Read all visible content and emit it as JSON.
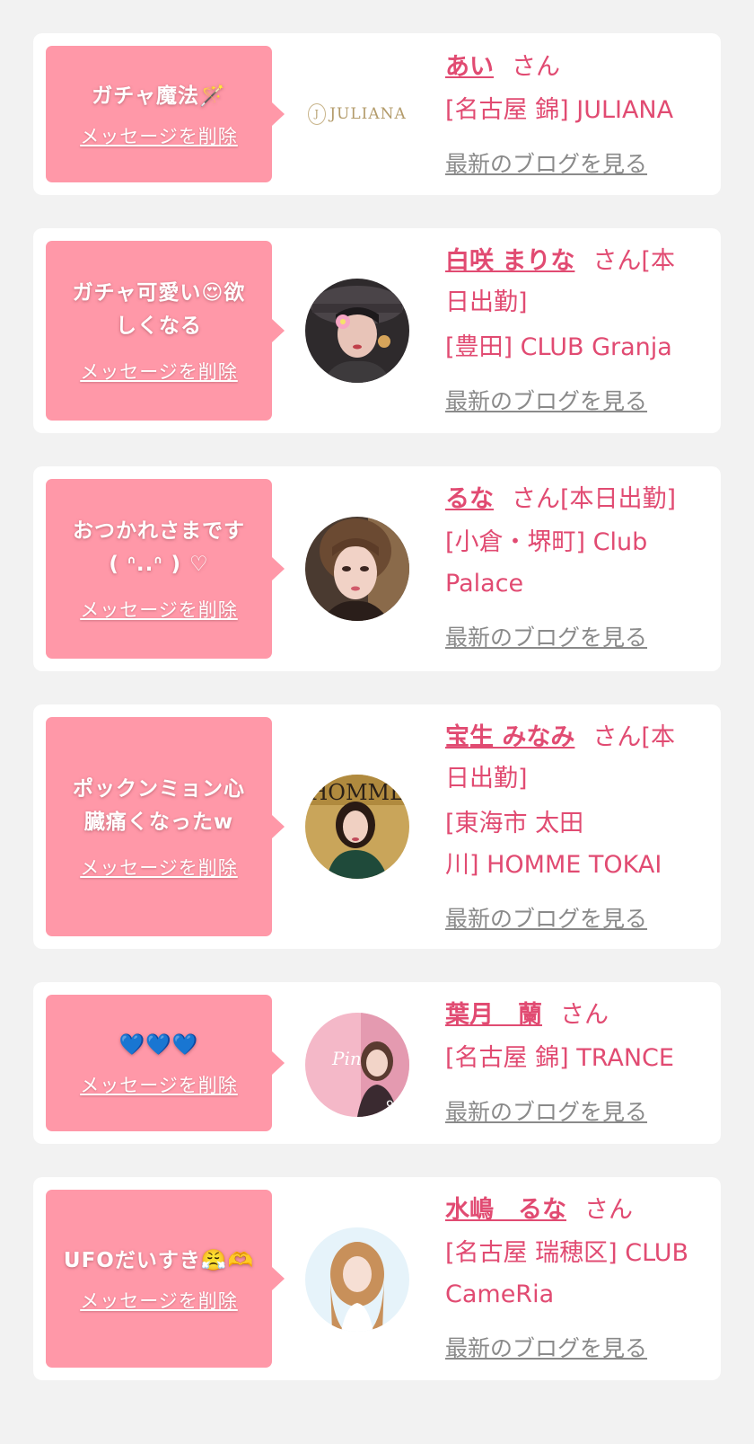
{
  "common": {
    "delete_label": "メッセージを削除",
    "san_suffix": "さん",
    "blog_label": "最新のブログを見る"
  },
  "colors": {
    "bubble": "#ff98a8",
    "accent": "#e14b72",
    "muted": "#8a8a8a",
    "background": "#f2f2f2"
  },
  "cards": [
    {
      "message_line1": "ガチャ魔法🪄",
      "message_line2": "",
      "name": "あい",
      "suffix": "さん",
      "shop_line1": "[名古屋 錦] JULIANA",
      "shop_line2": "",
      "image": "juliana-logo",
      "logo_text": "JULIANA"
    },
    {
      "message_line1": "ガチャ可愛い😍欲",
      "message_line2": "しくなる",
      "name": "白咲 まりな",
      "suffix": "さん[本",
      "suffix2": "日出勤]",
      "shop_line1": "[豊田] CLUB Granja",
      "shop_line2": "",
      "image": "avatar-photo"
    },
    {
      "message_line1": "おつかれさまです",
      "message_line2": "( ᐢ..ᐢ ) ♡",
      "name": "るな",
      "suffix": "さん[本日出勤]",
      "shop_line1": "[小倉・堺町] Club",
      "shop_line2": "Palace",
      "image": "avatar-photo"
    },
    {
      "message_line1": "ポックンミョン心",
      "message_line2": "臓痛くなったw",
      "name": "宝生 みなみ",
      "suffix": "さん[本",
      "suffix2": "日出勤]",
      "shop_line1": "[東海市 太田",
      "shop_line2": "川] HOMME TOKAI",
      "image": "avatar-photo"
    },
    {
      "message_line1": "💙💙💙",
      "message_line2": "",
      "name": "葉月　蘭",
      "suffix": "さん",
      "shop_line1": "[名古屋 錦] TRANCE",
      "shop_line2": "",
      "image": "avatar-photo"
    },
    {
      "message_line1": "UFOだいすき😤🫶",
      "message_line2": "",
      "name": "水嶋　るな",
      "suffix": "さん",
      "shop_line1": "[名古屋 瑞穂区] CLUB",
      "shop_line2": "CameRia",
      "image": "avatar-photo"
    }
  ]
}
